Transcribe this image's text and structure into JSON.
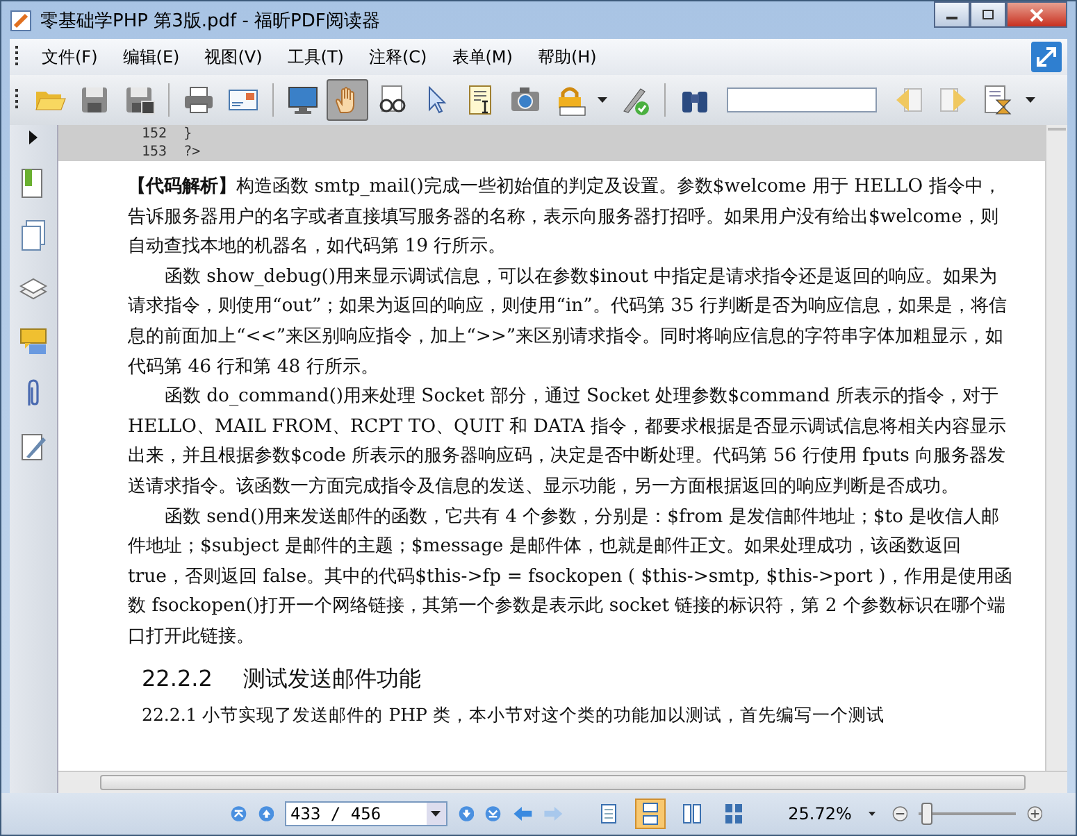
{
  "window": {
    "title": "零基础学PHP  第3版.pdf - 福昕PDF阅读器"
  },
  "menu": [
    {
      "label": "文件(F)"
    },
    {
      "label": "编辑(E)"
    },
    {
      "label": "视图(V)"
    },
    {
      "label": "工具(T)"
    },
    {
      "label": "注释(C)"
    },
    {
      "label": "表单(M)"
    },
    {
      "label": "帮助(H)"
    }
  ],
  "toolbar": {
    "groups": [
      [
        {
          "kind": "open",
          "selected": false
        },
        {
          "kind": "save",
          "selected": false
        },
        {
          "kind": "saveas",
          "selected": false
        }
      ],
      [
        {
          "kind": "print",
          "selected": false
        },
        {
          "kind": "email",
          "selected": false
        }
      ],
      [
        {
          "kind": "monitor",
          "selected": false
        },
        {
          "kind": "hand",
          "selected": true
        },
        {
          "kind": "glasses",
          "selected": false
        },
        {
          "kind": "pointer",
          "selected": false
        },
        {
          "kind": "textselect",
          "selected": false
        },
        {
          "kind": "camera",
          "selected": false
        },
        {
          "kind": "lock",
          "selected": false,
          "dropdown": true
        },
        {
          "kind": "pen",
          "selected": false
        }
      ],
      [
        {
          "kind": "binoculars",
          "selected": false
        },
        {
          "kind": "search",
          "selected": false
        },
        {
          "kind": "prevfind",
          "selected": false
        },
        {
          "kind": "nextfind",
          "selected": false
        },
        {
          "kind": "hourglass",
          "selected": false,
          "dropdown": true
        }
      ]
    ]
  },
  "sidebar": [
    {
      "kind": "bookmark"
    },
    {
      "kind": "pages"
    },
    {
      "kind": "layers"
    },
    {
      "kind": "comments"
    },
    {
      "kind": "attachment"
    },
    {
      "kind": "signature"
    }
  ],
  "document": {
    "code_lines": [
      "152  }",
      "153  ?>"
    ],
    "paragraphs": [
      "**【代码解析】**构造函数 smtp_mail()完成一些初始值的判定及设置。参数$welcome 用于 HELLO 指令中，告诉服务器用户的名字或者直接填写服务器的名称，表示向服务器打招呼。如果用户没有给出$welcome，则自动查找本地的机器名，如代码第 19 行所示。",
      "函数 show_debug()用来显示调试信息，可以在参数$inout 中指定是请求指令还是返回的响应。如果为请求指令，则使用“out”；如果为返回的响应，则使用“in”。代码第 35 行判断是否为响应信息，如果是，将信息的前面加上“<<”来区别响应指令，加上“>>”来区别请求指令。同时将响应信息的字符串字体加粗显示，如代码第 46 行和第 48 行所示。",
      "函数 do_command()用来处理 Socket 部分，通过 Socket 处理参数$command 所表示的指令，对于 HELLO、MAIL FROM、RCPT TO、QUIT 和 DATA 指令，都要求根据是否显示调试信息将相关内容显示出来，并且根据参数$code 所表示的服务器响应码，决定是否中断处理。代码第 56 行使用 fputs 向服务器发送请求指令。该函数一方面完成指令及信息的发送、显示功能，另一方面根据返回的响应判断是否成功。",
      "函数 send()用来发送邮件的函数，它共有 4 个参数，分别是：$from 是发信邮件地址；$to 是收信人邮件地址；$subject 是邮件的主题；$message 是邮件体，也就是邮件正文。如果处理成功，该函数返回 true，否则返回 false。其中的代码$this->fp = fsockopen ( $this->smtp, $this->port )，作用是使用函数 fsockopen()打开一个网络链接，其第一个参数是表示此 socket 链接的标识符，第 2 个参数标识在哪个端口打开此链接。"
    ],
    "heading": {
      "number": "22.2.2",
      "title": "测试发送邮件功能"
    },
    "cut_line": "22.2.1 小节实现了发送邮件的 PHP 类，本小节对这个类的功能加以测试，首先编写一个测试"
  },
  "status_bar": {
    "page_field": "433 / 456",
    "views": [
      {
        "kind": "single",
        "selected": false
      },
      {
        "kind": "continuous",
        "selected": true
      },
      {
        "kind": "facing",
        "selected": false
      },
      {
        "kind": "cont-facing",
        "selected": false
      }
    ],
    "zoom": "25.72%",
    "zoom_slider": {
      "level": 0.08
    }
  }
}
